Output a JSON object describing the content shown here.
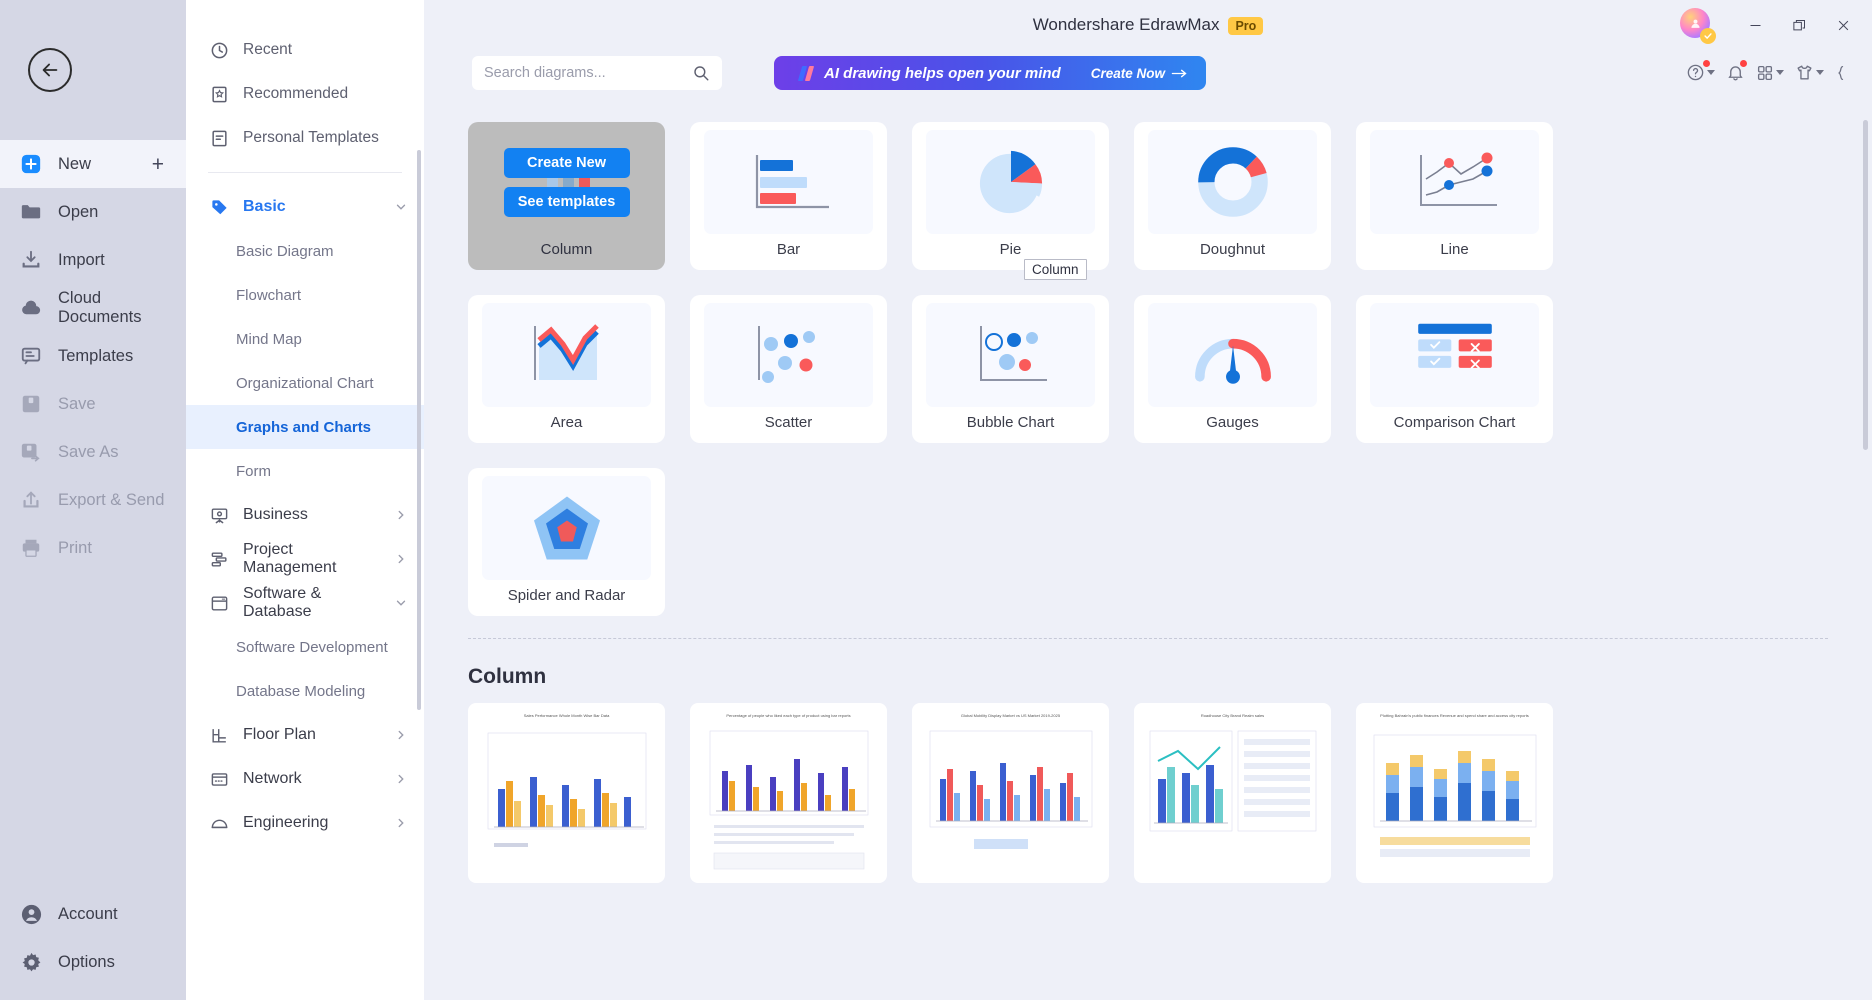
{
  "window": {
    "app_title": "Wondershare EdrawMax",
    "pro_badge": "Pro",
    "minimize": "–",
    "restore": "❐",
    "close": "✕"
  },
  "rail": {
    "back_label": "Back",
    "items": [
      {
        "label": "New",
        "icon": "new-plus-icon",
        "state": "active",
        "trailing": "+"
      },
      {
        "label": "Open",
        "icon": "folder-icon",
        "state": "normal"
      },
      {
        "label": "Import",
        "icon": "import-icon",
        "state": "normal"
      },
      {
        "label": "Cloud Documents",
        "icon": "cloud-icon",
        "state": "normal"
      },
      {
        "label": "Templates",
        "icon": "templates-icon",
        "state": "normal"
      },
      {
        "label": "Save",
        "icon": "save-icon",
        "state": "disabled"
      },
      {
        "label": "Save As",
        "icon": "save-as-icon",
        "state": "disabled"
      },
      {
        "label": "Export & Send",
        "icon": "export-icon",
        "state": "disabled"
      },
      {
        "label": "Print",
        "icon": "print-icon",
        "state": "disabled"
      }
    ],
    "bottom": [
      {
        "label": "Account",
        "icon": "account-icon"
      },
      {
        "label": "Options",
        "icon": "gear-icon"
      }
    ]
  },
  "categories": {
    "top": [
      {
        "label": "Recent",
        "icon": "clock-icon"
      },
      {
        "label": "Recommended",
        "icon": "bookmark-star-icon"
      },
      {
        "label": "Personal Templates",
        "icon": "personal-templates-icon"
      }
    ],
    "groups": [
      {
        "label": "Basic",
        "icon": "tag-icon",
        "expanded": true,
        "chevron": "chevron-down-icon",
        "children": [
          {
            "label": "Basic Diagram",
            "selected": false
          },
          {
            "label": "Flowchart",
            "selected": false
          },
          {
            "label": "Mind Map",
            "selected": false
          },
          {
            "label": "Organizational Chart",
            "selected": false
          },
          {
            "label": "Graphs and Charts",
            "selected": true
          },
          {
            "label": "Form",
            "selected": false
          }
        ]
      },
      {
        "label": "Business",
        "icon": "business-icon",
        "expanded": false,
        "chevron": "chevron-right-icon",
        "children": []
      },
      {
        "label": "Project Management",
        "icon": "project-icon",
        "expanded": false,
        "chevron": "chevron-right-icon",
        "children": []
      },
      {
        "label": "Software & Database",
        "icon": "software-icon",
        "expanded": true,
        "chevron": "chevron-down-icon",
        "children": [
          {
            "label": "Software Development",
            "selected": false
          },
          {
            "label": "Database Modeling",
            "selected": false
          }
        ]
      },
      {
        "label": "Floor Plan",
        "icon": "floorplan-icon",
        "expanded": false,
        "chevron": "chevron-right-icon",
        "children": []
      },
      {
        "label": "Network",
        "icon": "network-icon",
        "expanded": false,
        "chevron": "chevron-right-icon",
        "children": []
      },
      {
        "label": "Engineering",
        "icon": "engineering-icon",
        "expanded": false,
        "chevron": "chevron-right-icon",
        "children": []
      }
    ]
  },
  "search": {
    "placeholder": "Search diagrams...",
    "value": "",
    "icon": "search-icon"
  },
  "ai_banner": {
    "text": "AI drawing helps open your mind",
    "cta": "Create Now",
    "cta_arrow": "→",
    "mark": "ai-slash-icon"
  },
  "header_icons": [
    {
      "name": "help-icon",
      "glyph": "?",
      "badge": true,
      "caret": true
    },
    {
      "name": "notification-bell-icon",
      "glyph": "bell",
      "badge": true,
      "caret": false
    },
    {
      "name": "apps-grid-icon",
      "glyph": "grid",
      "badge": false,
      "caret": true
    },
    {
      "name": "theme-shirt-icon",
      "glyph": "shirt",
      "badge": false,
      "caret": true
    },
    {
      "name": "settings-braces-icon",
      "glyph": "braces",
      "badge": false,
      "caret": false
    }
  ],
  "chart_cards": [
    {
      "name": "Column",
      "icon": "column-chart-icon",
      "hovered": true
    },
    {
      "name": "Bar",
      "icon": "bar-chart-icon",
      "hovered": false
    },
    {
      "name": "Pie",
      "icon": "pie-chart-icon",
      "hovered": false
    },
    {
      "name": "Doughnut",
      "icon": "doughnut-chart-icon",
      "hovered": false
    },
    {
      "name": "Line",
      "icon": "line-chart-icon",
      "hovered": false
    },
    {
      "name": "Area",
      "icon": "area-chart-icon",
      "hovered": false
    },
    {
      "name": "Scatter",
      "icon": "scatter-chart-icon",
      "hovered": false
    },
    {
      "name": "Bubble Chart",
      "icon": "bubble-chart-icon",
      "hovered": false
    },
    {
      "name": "Gauges",
      "icon": "gauge-chart-icon",
      "hovered": false
    },
    {
      "name": "Comparison Chart",
      "icon": "comparison-chart-icon",
      "hovered": false
    },
    {
      "name": "Spider and Radar",
      "icon": "radar-chart-icon",
      "hovered": false
    }
  ],
  "hover_card": {
    "create_new": "Create New",
    "see_templates": "See templates",
    "tooltip": "Column"
  },
  "templates_section": {
    "title": "Column",
    "items": [
      {
        "caption": "Sales Performance Whole Month Wise Bar Data"
      },
      {
        "caption": "Percentage of people who liked each type of product using bar reports"
      },
      {
        "caption": "Global Mobility Display Market vs US Market 2019-2025"
      },
      {
        "caption": "Roadhouse City Brand Realm sales"
      },
      {
        "caption": "Plotting Bahrain's public finances Revenue and spend share and access city reports"
      }
    ]
  },
  "colors": {
    "accent_blue": "#1281f2",
    "light_blue": "#bfdcfb",
    "red": "#fa5a5a",
    "selected_cat": "#1565d8",
    "rail_bg": "#d5d7e5",
    "main_bg": "#eef0f8",
    "pro_yellow": "#ffc845"
  }
}
